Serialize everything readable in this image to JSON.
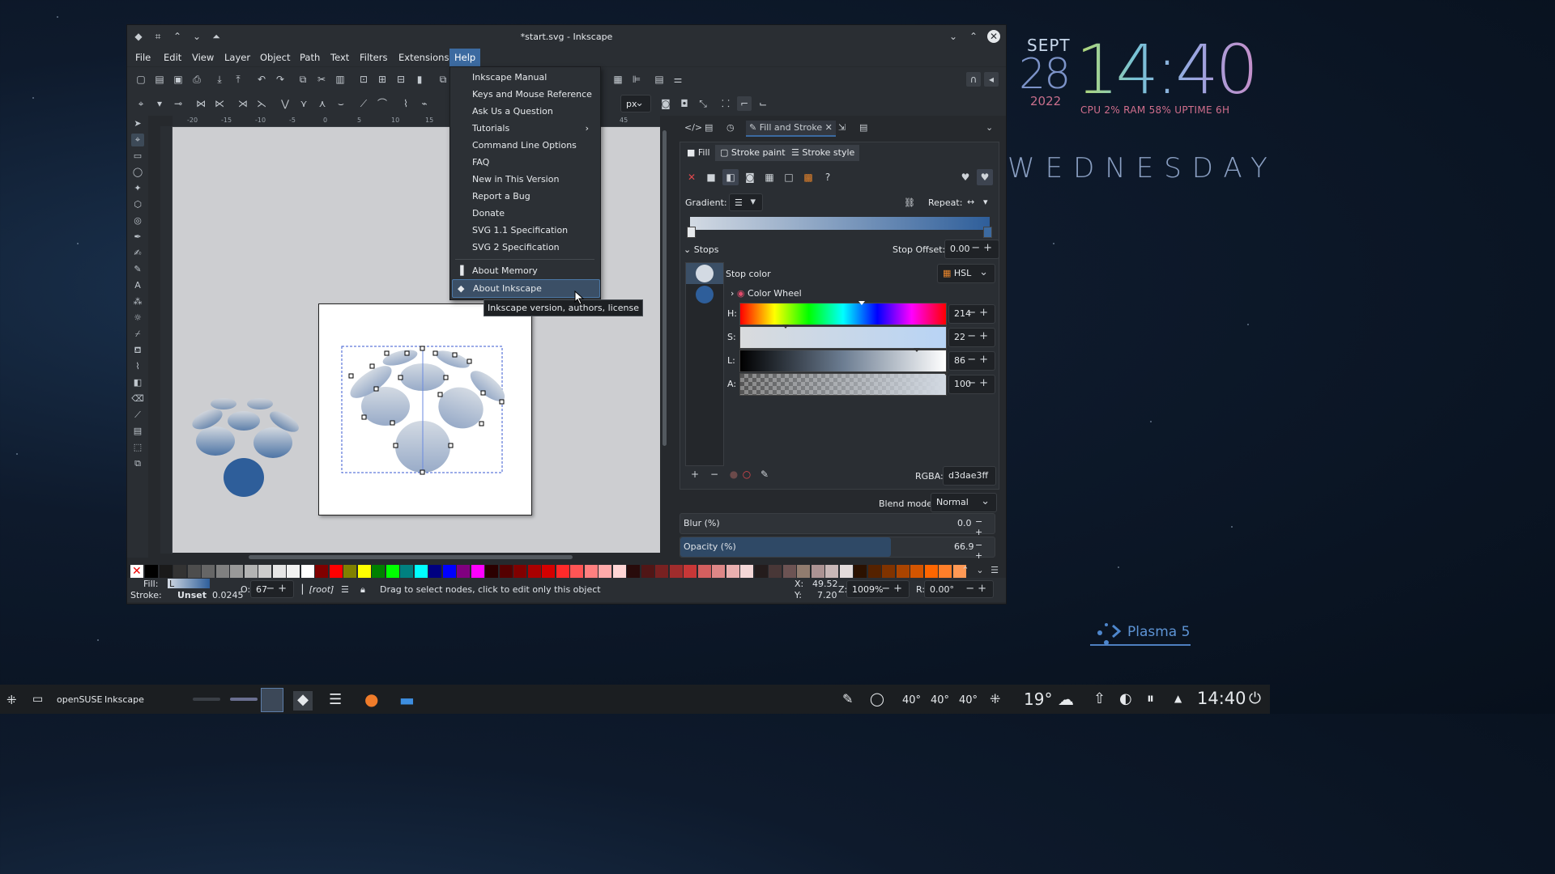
{
  "desktop": {
    "clock": {
      "month": "SEPT",
      "day": "28",
      "year": "2022",
      "time": "14:40",
      "sysinfo": "CPU 2% RAM 58% UPTIME 6H"
    },
    "weekday": "WEDNESDAY",
    "plasma_badge": "Plasma 5"
  },
  "window": {
    "title": "*start.svg - Inkscape",
    "menus": [
      "File",
      "Edit",
      "View",
      "Layer",
      "Object",
      "Path",
      "Text",
      "Filters",
      "Extensions",
      "Help"
    ],
    "active_menu": "Help",
    "unit": "px"
  },
  "help_menu": {
    "items": [
      "Inkscape Manual",
      "Keys and Mouse Reference",
      "Ask Us a Question",
      "Tutorials",
      "Command Line Options",
      "FAQ",
      "New in This Version",
      "Report a Bug",
      "Donate",
      "SVG 1.1 Specification",
      "SVG 2 Specification"
    ],
    "about_memory": "About Memory",
    "about_inkscape": "About Inkscape",
    "tooltip": "Inkscape version, authors, license"
  },
  "ruler": {
    "labels": [
      "-20",
      "-15",
      "-10",
      "-5",
      "0",
      "5",
      "10",
      "15",
      "45"
    ]
  },
  "dock": {
    "tab_fill_stroke": "Fill and Stroke",
    "subtabs": {
      "fill": "Fill",
      "stroke_paint": "Stroke paint",
      "stroke_style": "Stroke style"
    },
    "gradient_label": "Gradient:",
    "repeat_label": "Repeat:",
    "stops_label": "Stops",
    "stop_offset_label": "Stop Offset:",
    "stop_offset_value": "0.00",
    "stop_color_label": "Stop color",
    "color_mode": "HSL",
    "color_wheel": "Color Wheel",
    "hsl": [
      {
        "label": "H:",
        "value": "214",
        "level": 0.59
      },
      {
        "label": "S:",
        "value": "22",
        "level": 0.22
      },
      {
        "label": "L:",
        "value": "86",
        "level": 0.86
      },
      {
        "label": "A:",
        "value": "100",
        "level": 1.0
      }
    ],
    "rgba_label": "RGBA:",
    "rgba_value": "d3dae3ff",
    "blend_label": "Blend mode:",
    "blend_value": "Normal",
    "blur_label": "Blur (%)",
    "blur_value": "0.0",
    "opacity_label": "Opacity (%)",
    "opacity_value": "66.9",
    "opacity_level": 0.669
  },
  "status": {
    "fill_label": "Fill:",
    "fill_value": "L",
    "stroke_label": "Stroke:",
    "stroke_value": "Unset",
    "stroke_width": "0.0245",
    "opacity_label": "O:",
    "opacity_value": "67",
    "layer": "[root]",
    "message": "Drag to select nodes, click to edit only this object",
    "x_label": "X:",
    "x_value": "49.52",
    "y_label": "Y:",
    "y_value": "7.20",
    "zoom_label": "Z:",
    "zoom_value": "1009%",
    "rotate_label": "R:",
    "rotate_value": "0.00°"
  },
  "taskbar": {
    "distro": "openSUSE",
    "app": "Inkscape",
    "temps": [
      "40°",
      "40°",
      "40°"
    ],
    "weather": "19°",
    "clock": "14:40"
  },
  "colors": {
    "accent": "#3c6aa0",
    "gradient_start": "#d3dae3",
    "gradient_end": "#2e5e9a"
  }
}
